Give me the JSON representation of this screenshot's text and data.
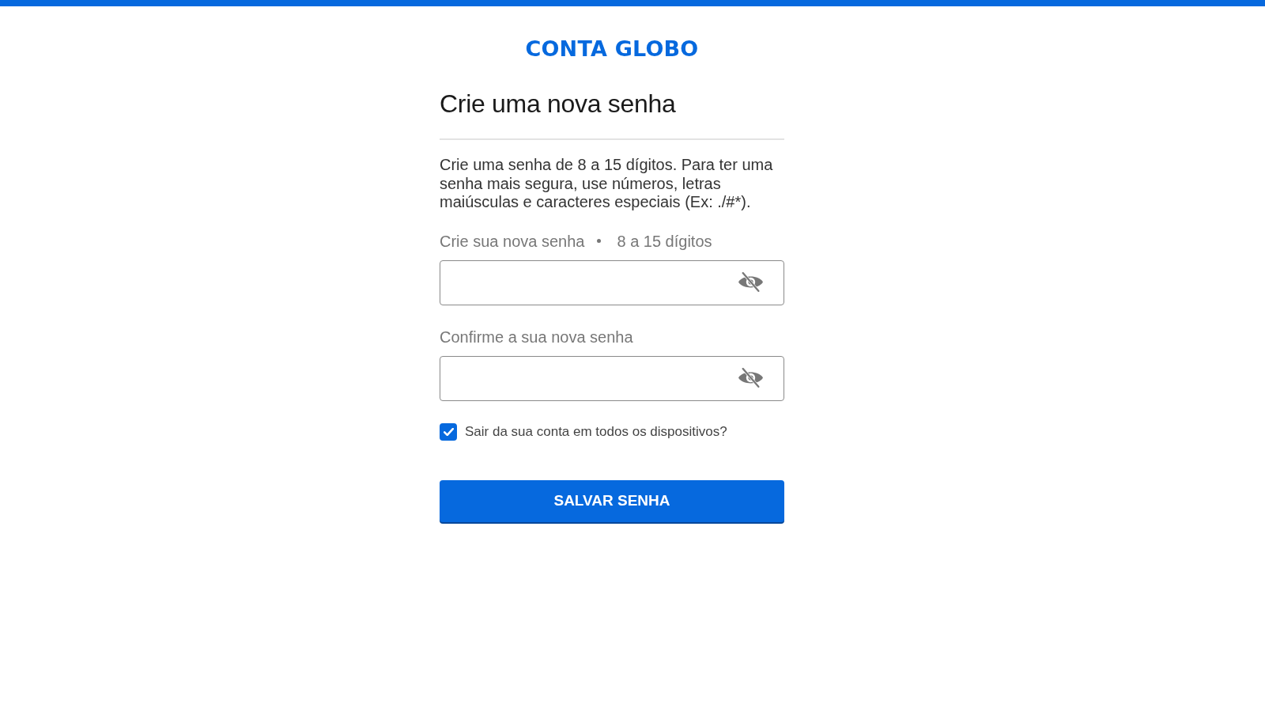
{
  "logo": {
    "text": "CONTA GLOBO"
  },
  "title": "Crie uma nova senha",
  "description": "Crie uma senha de 8 a 15 dígitos. Para ter uma senha mais segura, use números, letras maiúsculas e caracteres especiais (Ex: ./#*).",
  "fields": [
    {
      "label": "Crie sua nova senha",
      "hint": "8 a 15 dígitos",
      "revealed": false
    },
    {
      "label": "Confirme a sua nova senha",
      "revealed": false
    }
  ],
  "checkbox": {
    "label": "Sair da sua conta em todos os dispositivos?",
    "checked": true
  },
  "button": {
    "label": "SALVAR SENHA"
  }
}
